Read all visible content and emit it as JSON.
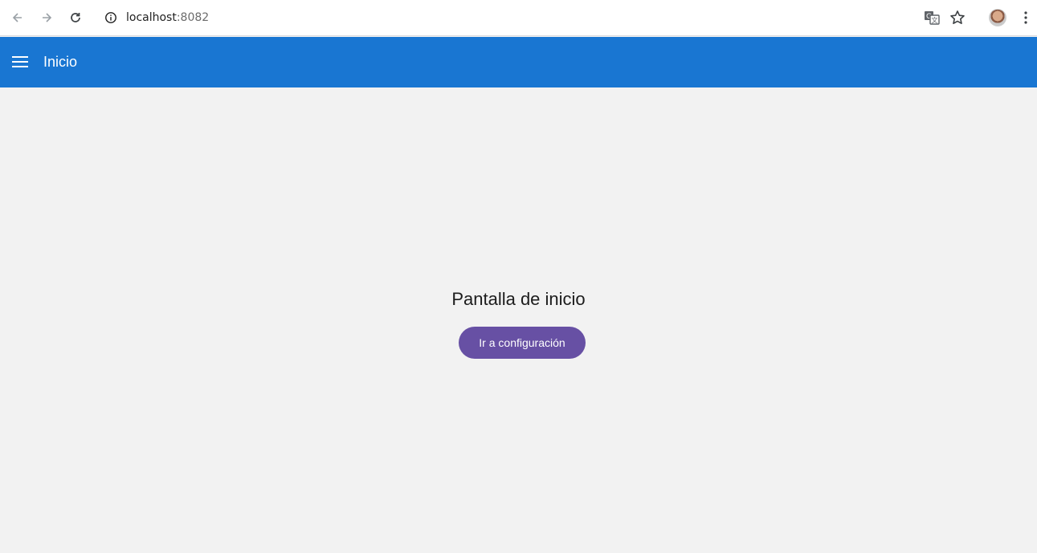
{
  "browser": {
    "url_host": "localhost",
    "url_port": ":8082",
    "icons": {
      "back": "arrow-left",
      "forward": "arrow-right",
      "reload": "reload",
      "site_info": "info",
      "translate": "translate",
      "bookmark": "star",
      "profile": "avatar",
      "menu": "kebab"
    }
  },
  "app_bar": {
    "title": "Inicio",
    "color": "#1976d2",
    "menu_icon": "hamburger"
  },
  "main": {
    "heading": "Pantalla de inicio",
    "button_label": "Ir a configuración",
    "button_color": "#6750a4"
  }
}
